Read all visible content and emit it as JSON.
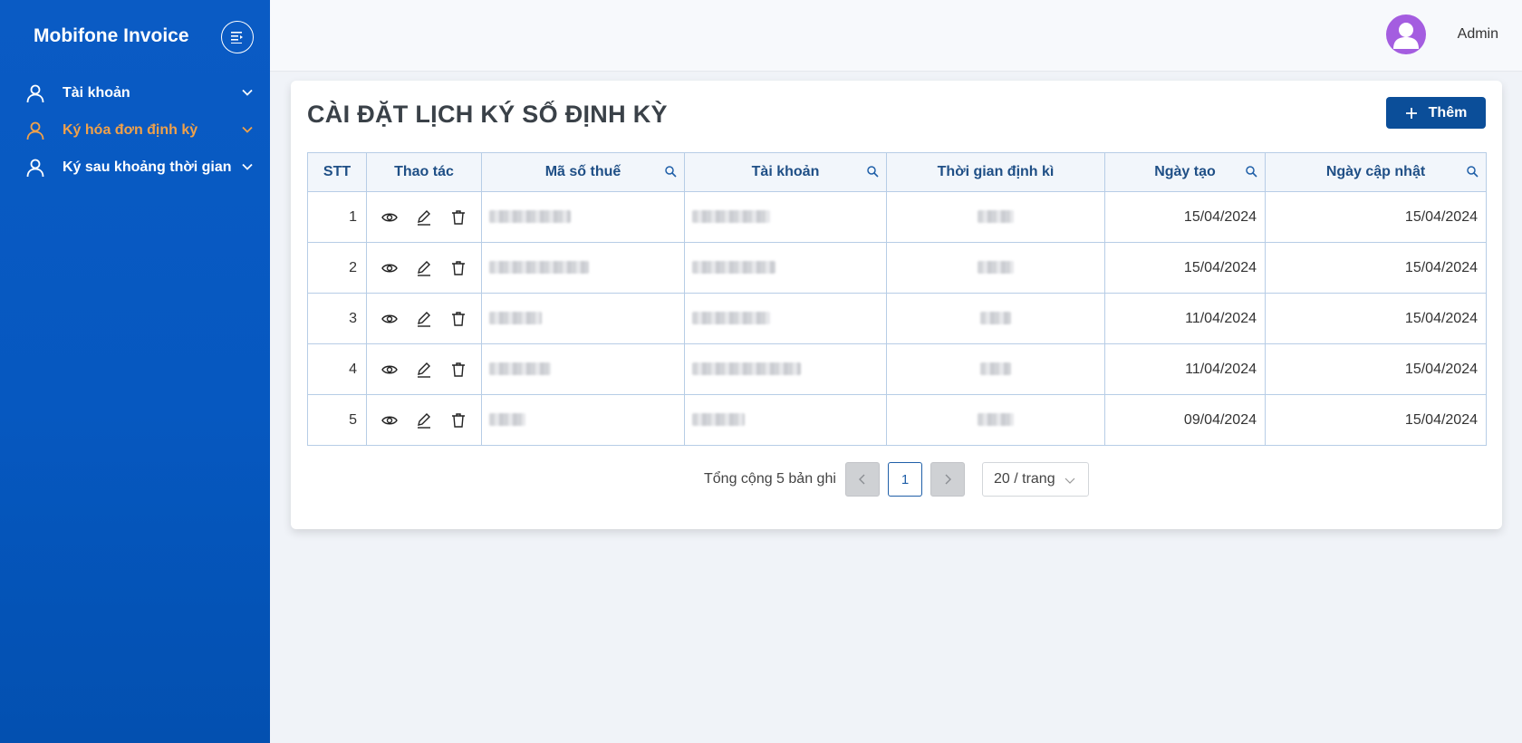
{
  "sidebar": {
    "brand": "Mobifone Invoice",
    "items": [
      {
        "label": "Tài khoản",
        "icon": "user-icon",
        "active": false
      },
      {
        "label": "Ký hóa đơn định kỳ",
        "icon": "user-icon",
        "active": true
      },
      {
        "label": "Ký sau khoảng thời gian",
        "icon": "user-icon",
        "active": false
      }
    ],
    "active_color": "#f0a14a"
  },
  "header": {
    "user_name": "Admin"
  },
  "main": {
    "title": "CÀI ĐẶT LỊCH KÝ SỐ ĐỊNH KỲ",
    "add_label": "Thêm",
    "columns": [
      "STT",
      "Thao tác",
      "Mã số thuế",
      "Tài khoản",
      "Thời gian định kì",
      "Ngày tạo",
      "Ngày cập nhật"
    ],
    "rows": [
      {
        "stt": "1",
        "created": "15/04/2024",
        "updated": "15/04/2024"
      },
      {
        "stt": "2",
        "created": "15/04/2024",
        "updated": "15/04/2024"
      },
      {
        "stt": "3",
        "created": "11/04/2024",
        "updated": "15/04/2024"
      },
      {
        "stt": "4",
        "created": "11/04/2024",
        "updated": "15/04/2024"
      },
      {
        "stt": "5",
        "created": "09/04/2024",
        "updated": "15/04/2024"
      }
    ],
    "pagination": {
      "total_text": "Tổng cộng 5 bản ghi",
      "current_page": "1",
      "page_size": "20 / trang"
    }
  },
  "colors": {
    "sidebar": "#0658c0",
    "primary_button": "#0b4e99",
    "header_text": "#1f4f86"
  }
}
